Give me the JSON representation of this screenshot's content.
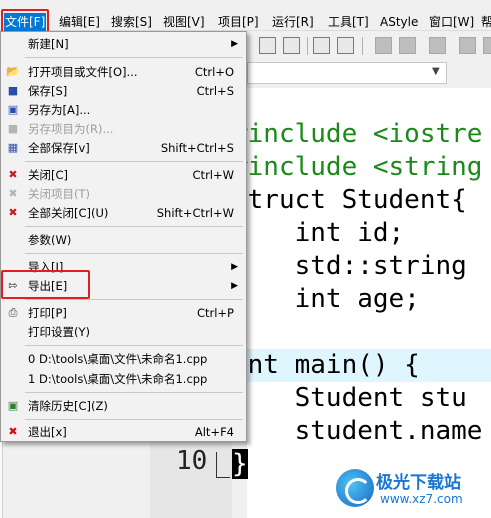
{
  "menubar": {
    "items": [
      {
        "label": "文件[F]"
      },
      {
        "label": "编辑[E]"
      },
      {
        "label": "搜索[S]"
      },
      {
        "label": "视图[V]"
      },
      {
        "label": "项目[P]"
      },
      {
        "label": "运行[R]"
      },
      {
        "label": "工具[T]"
      },
      {
        "label": "AStyle"
      },
      {
        "label": "窗口[W]"
      },
      {
        "label": "帮"
      }
    ]
  },
  "file_menu": {
    "items": [
      {
        "label": "新建[N]",
        "shortcut": "",
        "submenu": true
      },
      {
        "label": "打开项目或文件[O]...",
        "shortcut": "Ctrl+O",
        "icon": "open-icon"
      },
      {
        "label": "保存[S]",
        "shortcut": "Ctrl+S",
        "icon": "save-icon"
      },
      {
        "label": "另存为[A]...",
        "shortcut": "",
        "icon": "save-as-icon"
      },
      {
        "label": "另存项目为(R)...",
        "shortcut": "",
        "disabled": true,
        "icon": "save-project-icon"
      },
      {
        "label": "全部保存[v]",
        "shortcut": "Shift+Ctrl+S",
        "icon": "save-all-icon"
      },
      {
        "label": "关闭[C]",
        "shortcut": "Ctrl+W",
        "icon": "close-file-icon"
      },
      {
        "label": "关闭项目(T)",
        "shortcut": "",
        "disabled": true,
        "icon": "close-project-icon"
      },
      {
        "label": "全部关闭[C](U)",
        "shortcut": "Shift+Ctrl+W",
        "icon": "close-all-icon"
      },
      {
        "label": "参数(W)",
        "shortcut": ""
      },
      {
        "label": "导入[I]",
        "shortcut": "",
        "submenu": true
      },
      {
        "label": "导出[E]",
        "shortcut": "",
        "submenu": true,
        "icon": "export-icon"
      },
      {
        "label": "打印[P]",
        "shortcut": "Ctrl+P",
        "icon": "print-icon"
      },
      {
        "label": "打印设置(Y)",
        "shortcut": ""
      },
      {
        "label": "0 D:\\tools\\桌面\\文件\\未命名1.cpp",
        "shortcut": ""
      },
      {
        "label": "1 D:\\tools\\桌面\\文件\\未命名1.cpp",
        "shortcut": ""
      },
      {
        "label": "清除历史[C](Z)",
        "shortcut": "",
        "icon": "clear-history-icon"
      },
      {
        "label": "退出[x]",
        "shortcut": "Alt+F4",
        "icon": "exit-icon"
      }
    ]
  },
  "editor": {
    "lines": [
      {
        "text": "#include <iostre"
      },
      {
        "text": "#include <string"
      },
      {
        "text": "struct Student{"
      },
      {
        "text": "    int id;"
      },
      {
        "text": "    std::string"
      },
      {
        "text": "    int age;"
      },
      {
        "text": ""
      },
      {
        "text": "int main() {"
      },
      {
        "text": "    Student stu"
      },
      {
        "text": "    student.name"
      },
      {
        "text": "}"
      }
    ],
    "gutter_line_number": "10"
  },
  "watermark": {
    "title": "极光下载站",
    "url": "www.xz7.com"
  }
}
